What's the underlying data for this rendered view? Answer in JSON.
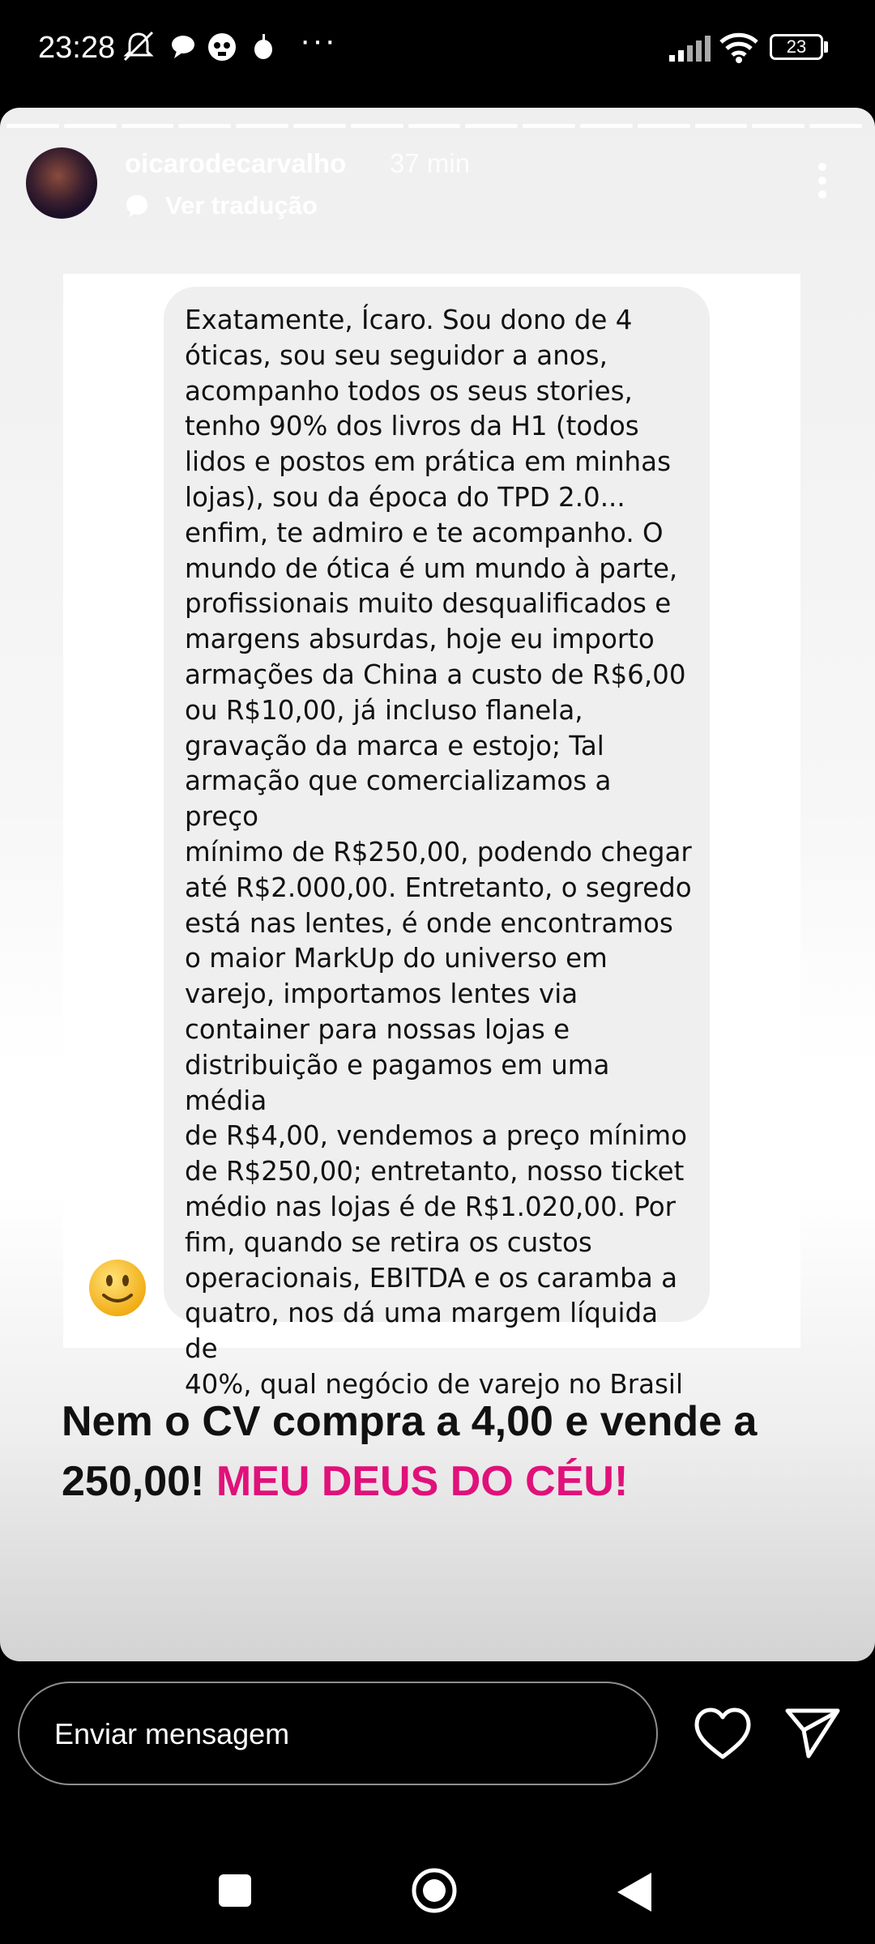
{
  "status_bar": {
    "time": "23:28",
    "battery": "23",
    "icons": [
      "mute-icon",
      "chat-icon",
      "skull-icon",
      "apple-icon",
      "more-dots-icon",
      "signal-icon",
      "wifi-icon",
      "battery-icon"
    ]
  },
  "story": {
    "progress_segments": 15,
    "username": "oicarodecarvalho",
    "time_ago": "37 min",
    "translate_label": "Ver tradução"
  },
  "message": {
    "text": "Exatamente, Ícaro. Sou dono de 4\nóticas, sou seu seguidor a anos,\nacompanho todos os seus stories,\ntenho 90% dos livros da H1 (todos\nlidos e postos em prática em minhas\nlojas), sou da época do TPD 2.0...\nenfim, te admiro e te acompanho. O\nmundo de ótica é um mundo à parte,\nprofissionais muito desqualificados e\nmargens absurdas, hoje eu importo\narmações da China a custo de R$6,00\nou R$10,00, já incluso flanela,\ngravação da marca e estojo; Tal\narmação que comercializamos a preço\nmínimo de R$250,00, podendo chegar\naté R$2.000,00. Entretanto, o segredo\nestá nas lentes, é onde encontramos\no maior MarkUp do universo em\nvarejo, importamos lentes via\ncontainer para nossas lojas e\ndistribuição e pagamos em uma média\nde R$4,00,  vendemos a preço mínimo\nde R$250,00; entretanto, nosso ticket\nmédio nas lojas é de R$1.020,00. Por\nfim, quando se retira os custos\noperacionais, EBITDA e os caramba a\nquatro, nos dá uma margem líquida de\n40%, qual negócio de varejo no Brasil"
  },
  "caption": {
    "main": "Nem o CV compra a 4,00 e vende a 250,00! ",
    "accent": "MEU DEUS DO CÉU!"
  },
  "footer": {
    "message_placeholder": "Enviar mensagem"
  },
  "colors": {
    "accent": "#e0117a",
    "background": "#000000",
    "bubble": "#efefef"
  }
}
